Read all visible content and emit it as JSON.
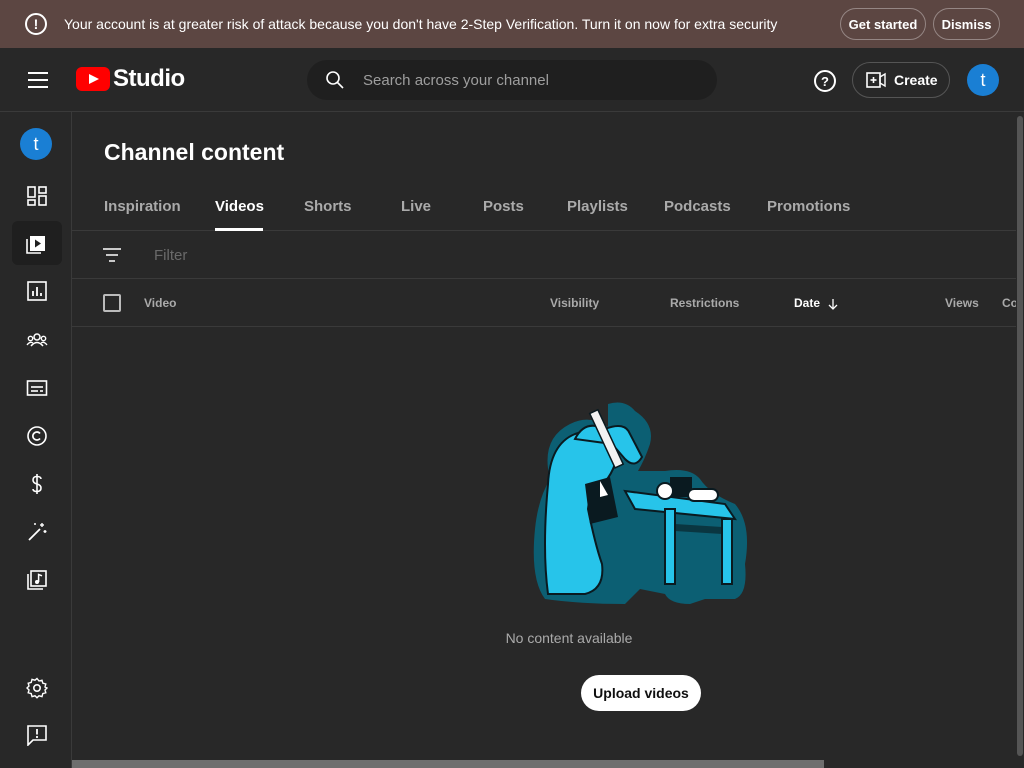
{
  "banner": {
    "message": "Your account is at greater risk of attack because you don't have 2-Step Verification. Turn it on now for extra security",
    "get_started": "Get started",
    "dismiss": "Dismiss",
    "icon": "warning-icon"
  },
  "header": {
    "logo_text": "Studio",
    "search_placeholder": "Search across your channel",
    "create_label": "Create",
    "avatar_letter": "t",
    "help_symbol": "?"
  },
  "sidebar": {
    "avatar_letter": "t",
    "items": [
      {
        "name": "dashboard-icon",
        "active": false
      },
      {
        "name": "content-icon",
        "active": true
      },
      {
        "name": "analytics-icon",
        "active": false
      },
      {
        "name": "community-icon",
        "active": false
      },
      {
        "name": "subtitles-icon",
        "active": false
      },
      {
        "name": "copyright-icon",
        "active": false
      },
      {
        "name": "earn-icon",
        "active": false
      },
      {
        "name": "customization-icon",
        "active": false
      },
      {
        "name": "audio-library-icon",
        "active": false
      },
      {
        "name": "settings-icon",
        "active": false
      },
      {
        "name": "feedback-icon",
        "active": false
      }
    ]
  },
  "main": {
    "title": "Channel content",
    "tabs": [
      "Inspiration",
      "Videos",
      "Shorts",
      "Live",
      "Posts",
      "Playlists",
      "Podcasts",
      "Promotions"
    ],
    "active_tab": "Videos",
    "filter_placeholder": "Filter",
    "columns": [
      "Video",
      "Visibility",
      "Restrictions",
      "Date",
      "Views",
      "Co"
    ],
    "sorted_column": "Date",
    "empty_text": "No content available",
    "upload_label": "Upload videos"
  },
  "colors": {
    "banner_bg": "#5c4642",
    "background": "#282828",
    "avatar": "#1a7fd4",
    "brand_red": "#ff0000",
    "illustration_teal": "#1b9bd1"
  }
}
